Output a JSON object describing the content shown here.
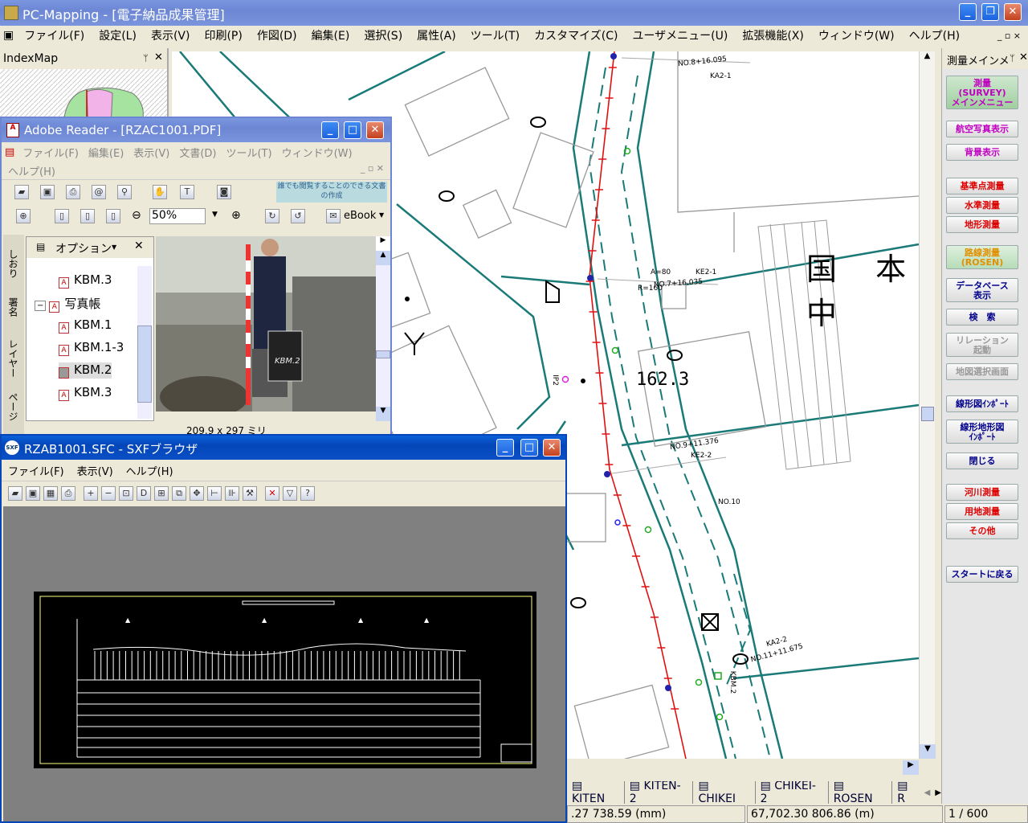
{
  "main_window": {
    "title": "PC-Mapping - [電子納品成果管理]",
    "menu": [
      "ファイル(F)",
      "設定(L)",
      "表示(V)",
      "印刷(P)",
      "作図(D)",
      "編集(E)",
      "選択(S)",
      "属性(A)",
      "ツール(T)",
      "カスタマイズ(C)",
      "ユーザメニュー(U)",
      "拡張機能(X)",
      "ウィンドウ(W)",
      "ヘルプ(H)"
    ]
  },
  "index_map": {
    "title": "IndexMap"
  },
  "map": {
    "labels": {
      "country_chars": "国 本 中",
      "elevation": "162.3",
      "station_top": "NO.8+16.095",
      "station_top_id": "KA2-1",
      "station_mid": "NO.7+16.035",
      "station_mid_id": "KE2-1",
      "station_low": "NO.9+11.376",
      "station_low_id": "KE2-2",
      "no10": "NO.10",
      "ka22": "KA2-2",
      "no11": "NO.11+11.675",
      "r160": "R=160",
      "a80": "A=80",
      "kbm2": "KBM.2",
      "ip2": "IP2"
    }
  },
  "side_panel": {
    "title": "測量メインメ",
    "buttons": [
      "測量\n(SURVEY)\nメインメニュー",
      "航空写真表示",
      "背景表示",
      "基準点測量",
      "水準測量",
      "地形測量",
      "路線測量\n(ROSEN)",
      "データベース\n表示",
      "検　索",
      "リレーション\n起動",
      "地図選択画面",
      "線形図ｲﾝﾎﾟｰﾄ",
      "線形地形図\nｲﾝﾎﾟｰﾄ",
      "閉じる",
      "河川測量",
      "用地測量",
      "その他",
      "スタートに戻る"
    ]
  },
  "adobe": {
    "title": "Adobe Reader - [RZAC1001.PDF]",
    "menu": [
      "ファイル(F)",
      "編集(E)",
      "表示(V)",
      "文書(D)",
      "ツール(T)",
      "ウィンドウ(W)"
    ],
    "menu2": "ヘルプ(H)",
    "banner": "誰でも閲覧することのできる文書の作成",
    "zoom": "50%",
    "ebook": "eBook",
    "option_label": "オプション",
    "side_tabs": [
      "しおり",
      "署名",
      "レイヤー",
      "ページ"
    ],
    "tree": {
      "item0": "KBM.3",
      "group": "写真帳",
      "items": [
        "KBM.1",
        "KBM.1-3",
        "KBM.2",
        "KBM.3"
      ]
    },
    "page_size": "209.9 x 297 ミリ",
    "photo_sign": "KBM.2"
  },
  "sxf": {
    "title": "RZAB1001.SFC - SXFブラウザ",
    "menu": [
      "ファイル(F)",
      "表示(V)",
      "ヘルプ(H)"
    ]
  },
  "bottom_tabs": [
    "KITEN",
    "KITEN-2",
    "CHIKEI",
    "CHIKEI-2",
    "ROSEN",
    "R"
  ],
  "status": {
    "coord1": ".27 738.59 (mm)",
    "coord2": "67,702.30 806.86 (m)",
    "page": "1 / 600"
  },
  "colors": {
    "road_teal": "#1a7a78",
    "route_red": "#e01010",
    "xp_blue": "#0a4fc6"
  }
}
